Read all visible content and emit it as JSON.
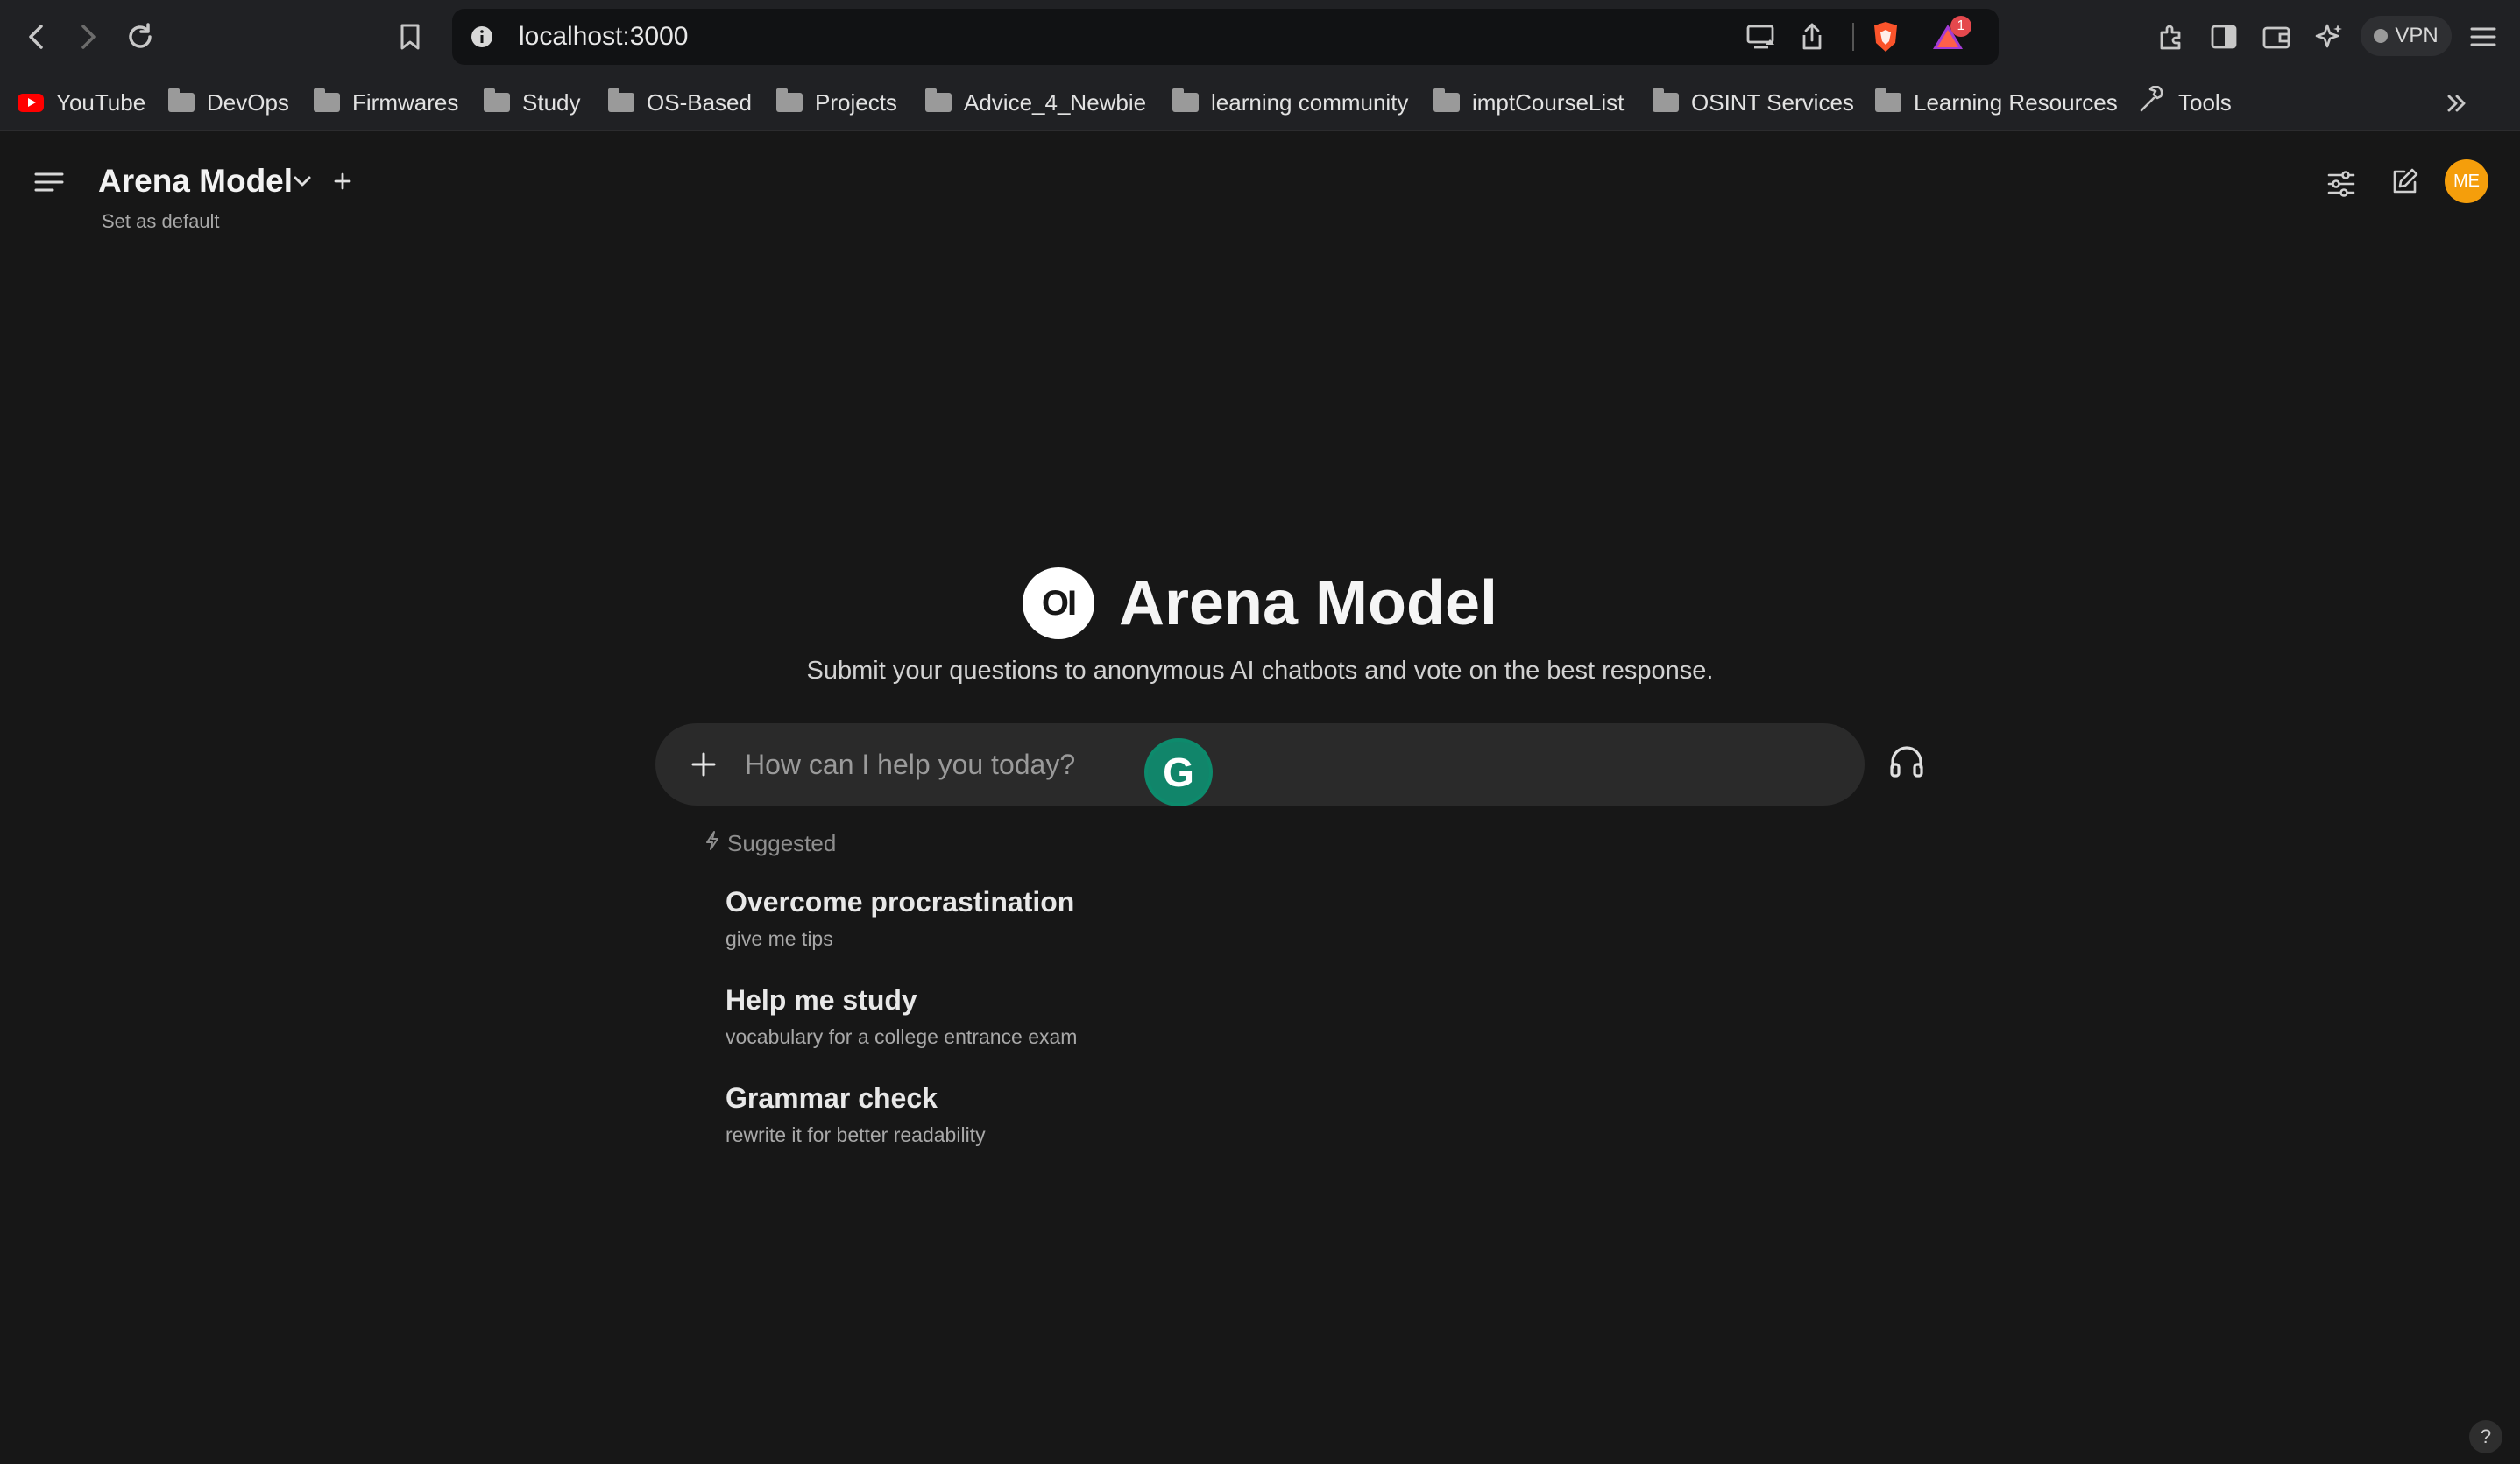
{
  "browser": {
    "url": "localhost:3000",
    "notification_count": "1",
    "vpn_label": "VPN"
  },
  "bookmarks": [
    {
      "label": "YouTube",
      "icon": "youtube-icon"
    },
    {
      "label": "DevOps",
      "icon": "folder-icon"
    },
    {
      "label": "Firmwares",
      "icon": "folder-icon"
    },
    {
      "label": "Study",
      "icon": "folder-icon"
    },
    {
      "label": "OS-Based",
      "icon": "folder-icon"
    },
    {
      "label": "Projects",
      "icon": "folder-icon"
    },
    {
      "label": "Advice_4_Newbie",
      "icon": "folder-icon"
    },
    {
      "label": "learning community",
      "icon": "folder-icon"
    },
    {
      "label": "imptCourseList",
      "icon": "folder-icon"
    },
    {
      "label": "OSINT Services",
      "icon": "folder-icon"
    },
    {
      "label": "Learning Resources",
      "icon": "folder-icon"
    },
    {
      "label": "Tools",
      "icon": "tools-icon"
    }
  ],
  "header": {
    "model_name": "Arena Model",
    "set_default": "Set as default",
    "avatar_initials": "ME"
  },
  "hero": {
    "logo_text": "OI",
    "title": "Arena Model",
    "subtitle": "Submit your questions to anonymous AI chatbots and vote on the best response."
  },
  "chat": {
    "placeholder": "How can I help you today?",
    "grammarly_letter": "G"
  },
  "suggested": {
    "label": "Suggested",
    "items": [
      {
        "title": "Overcome procrastination",
        "subtitle": "give me tips"
      },
      {
        "title": "Help me study",
        "subtitle": "vocabulary for a college entrance exam"
      },
      {
        "title": "Grammar check",
        "subtitle": "rewrite it for better readability"
      }
    ]
  },
  "help": "?",
  "colors": {
    "background": "#171717",
    "avatar": "#f59e0b",
    "brave": "#fb542b",
    "grammarly": "#11856a"
  }
}
